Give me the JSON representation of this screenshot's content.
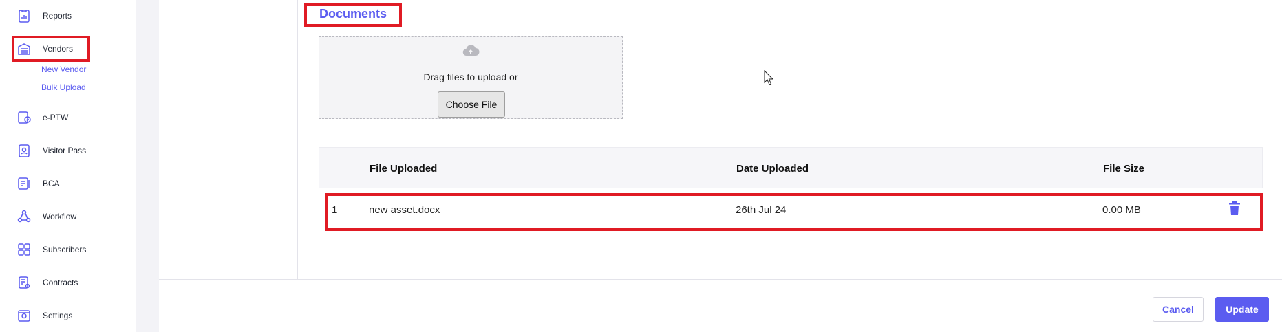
{
  "sidebar": {
    "items": [
      {
        "label": "Reports",
        "icon": "reports-icon"
      },
      {
        "label": "Vendors",
        "icon": "vendors-icon"
      },
      {
        "label": "e-PTW",
        "icon": "eptw-icon"
      },
      {
        "label": "Visitor Pass",
        "icon": "visitor-pass-icon"
      },
      {
        "label": "BCA",
        "icon": "bca-icon"
      },
      {
        "label": "Workflow",
        "icon": "workflow-icon"
      },
      {
        "label": "Subscribers",
        "icon": "subscribers-icon"
      },
      {
        "label": "Contracts",
        "icon": "contracts-icon"
      },
      {
        "label": "Settings",
        "icon": "settings-icon"
      }
    ],
    "vendor_subitems": [
      "New Vendor",
      "Bulk Upload"
    ]
  },
  "documents": {
    "title": "Documents",
    "drop_text": "Drag files to upload or",
    "choose_file_label": "Choose File"
  },
  "table": {
    "headers": [
      "File Uploaded",
      "Date Uploaded",
      "File Size"
    ],
    "rows": [
      {
        "index": "1",
        "file": "new asset.docx",
        "date": "26th Jul 24",
        "size": "0.00 MB"
      }
    ]
  },
  "footer": {
    "cancel_label": "Cancel",
    "update_label": "Update"
  },
  "colors": {
    "accent": "#5b5cf0",
    "highlight": "#e01b24"
  }
}
